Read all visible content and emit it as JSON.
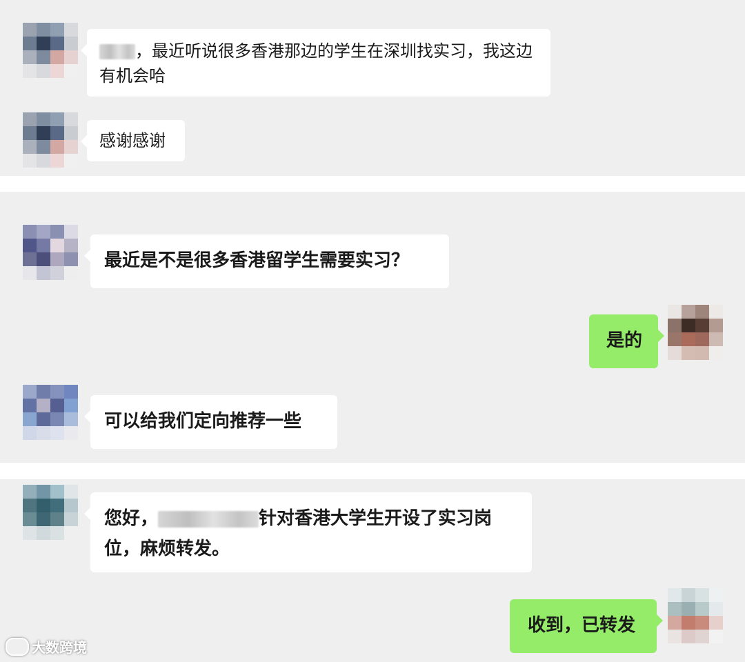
{
  "chat1": {
    "msg1_text": "，最近听说很多香港那边的学生在深圳找实习，我这边有机会哈",
    "msg2_text": "感谢感谢"
  },
  "chat2": {
    "msg1_text": "最近是不是很多香港留学生需要实习？",
    "msg2_text": "是的",
    "msg3_text": "可以给我们定向推荐一些"
  },
  "chat3": {
    "msg1_prefix": "您好，",
    "msg1_suffix": "针对香港大学生开设了实习岗位，麻烦转发。",
    "msg2_text": "收到，已转发"
  },
  "watermark": {
    "text": "大数跨境"
  },
  "icons": [
    "mosaic-avatar-icon",
    "brand-logo-icon"
  ]
}
